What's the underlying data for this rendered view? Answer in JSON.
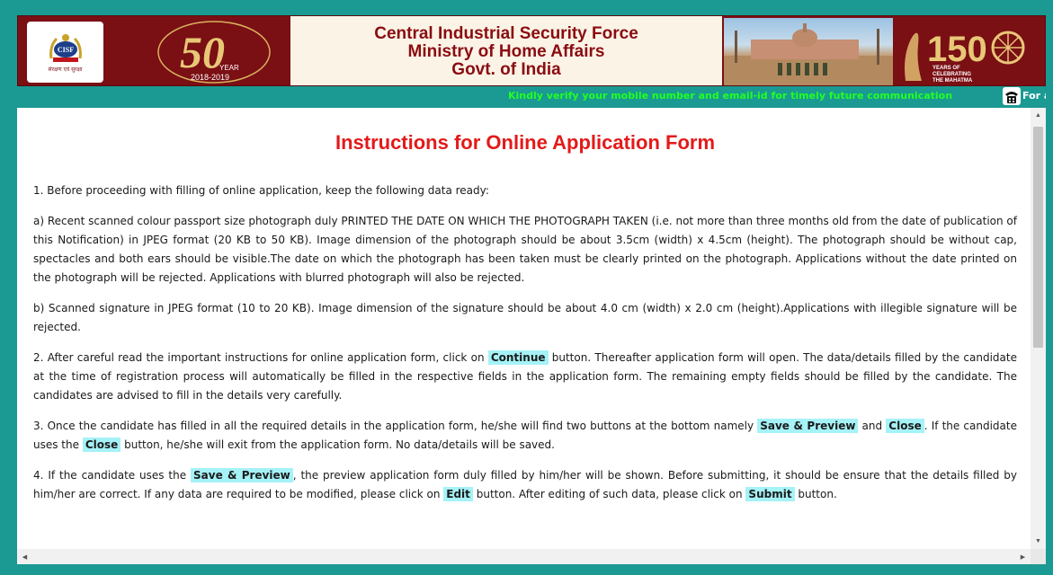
{
  "header": {
    "title_lines": [
      "Central Industrial Security Force",
      "Ministry of Home Affairs",
      "Govt. of India"
    ],
    "cisf_logo_text": "CISF",
    "cisf_motto": "संरक्षण एवं सुरक्षा",
    "anniversary_number": "50",
    "anniversary_label": "YEAR",
    "anniversary_years": "2018-2019",
    "mahatma_number": "150",
    "mahatma_label": [
      "YEARS OF",
      "CELEBRATING",
      "THE MAHATMA"
    ]
  },
  "marquee": {
    "text": "Kindly verify your mobile number and email-id for timely future communication",
    "tail": "For ar"
  },
  "main": {
    "title": "Instructions for Online Application Form",
    "p1": "1. Before proceeding with filling of online application, keep the following data ready:",
    "pa": "a) Recent scanned colour passport size photograph duly PRINTED THE DATE ON WHICH THE PHOTOGRAPH TAKEN (i.e. not more than three months old from the date of publication of this Notification) in JPEG format (20 KB to 50 KB). Image dimension of the photograph should be about 3.5cm (width) x 4.5cm (height). The photograph should be without cap, spectacles and both ears should be visible.The date on which the photograph has been taken must be clearly printed on the photograph. Applications without the date printed on the photograph will be rejected. Applications with blurred photograph will also be rejected.",
    "pb": "b) Scanned signature in JPEG format (10 to 20 KB). Image dimension of the signature should be about 4.0 cm (width) x 2.0 cm (height).Applications with illegible signature will be rejected.",
    "p2": {
      "before": "2. After careful read the important instructions for online application form, click on ",
      "button": "Continue",
      "after": " button. Thereafter application form will open. The data/details filled by the candidate at the time of registration process will automatically be filled in the respective fields in the application form. The remaining empty fields should be filled by the candidate. The candidates are advised to fill in the details very carefully."
    },
    "p3": {
      "part1": "3. Once the candidate has filled in all the required details in the application form, he/she will find two buttons at the bottom namely ",
      "btn_save": "Save & Preview",
      "part2": " and ",
      "btn_close": "Close",
      "part3": ". If the candidate uses the ",
      "btn_close2": "Close",
      "part4": " button, he/she will exit from the application form. No data/details will be saved."
    },
    "p4": {
      "part1": "4. If the candidate uses the ",
      "btn_save": "Save & Preview",
      "part2": ", the preview application form duly filled by him/her will be shown. Before submitting, it should be ensure that the details filled by him/her are correct. If any data are required to be modified, please click on ",
      "btn_edit": "Edit",
      "part3": " button. After editing of such data, please click on ",
      "btn_submit": "Submit",
      "part4": " button."
    }
  },
  "colors": {
    "page_bg": "#1a9a92",
    "banner_maroon": "#7a0f14",
    "title_red": "#e31a1a",
    "marquee_green": "#22ff22",
    "button_highlight": "#a5f2f7"
  }
}
